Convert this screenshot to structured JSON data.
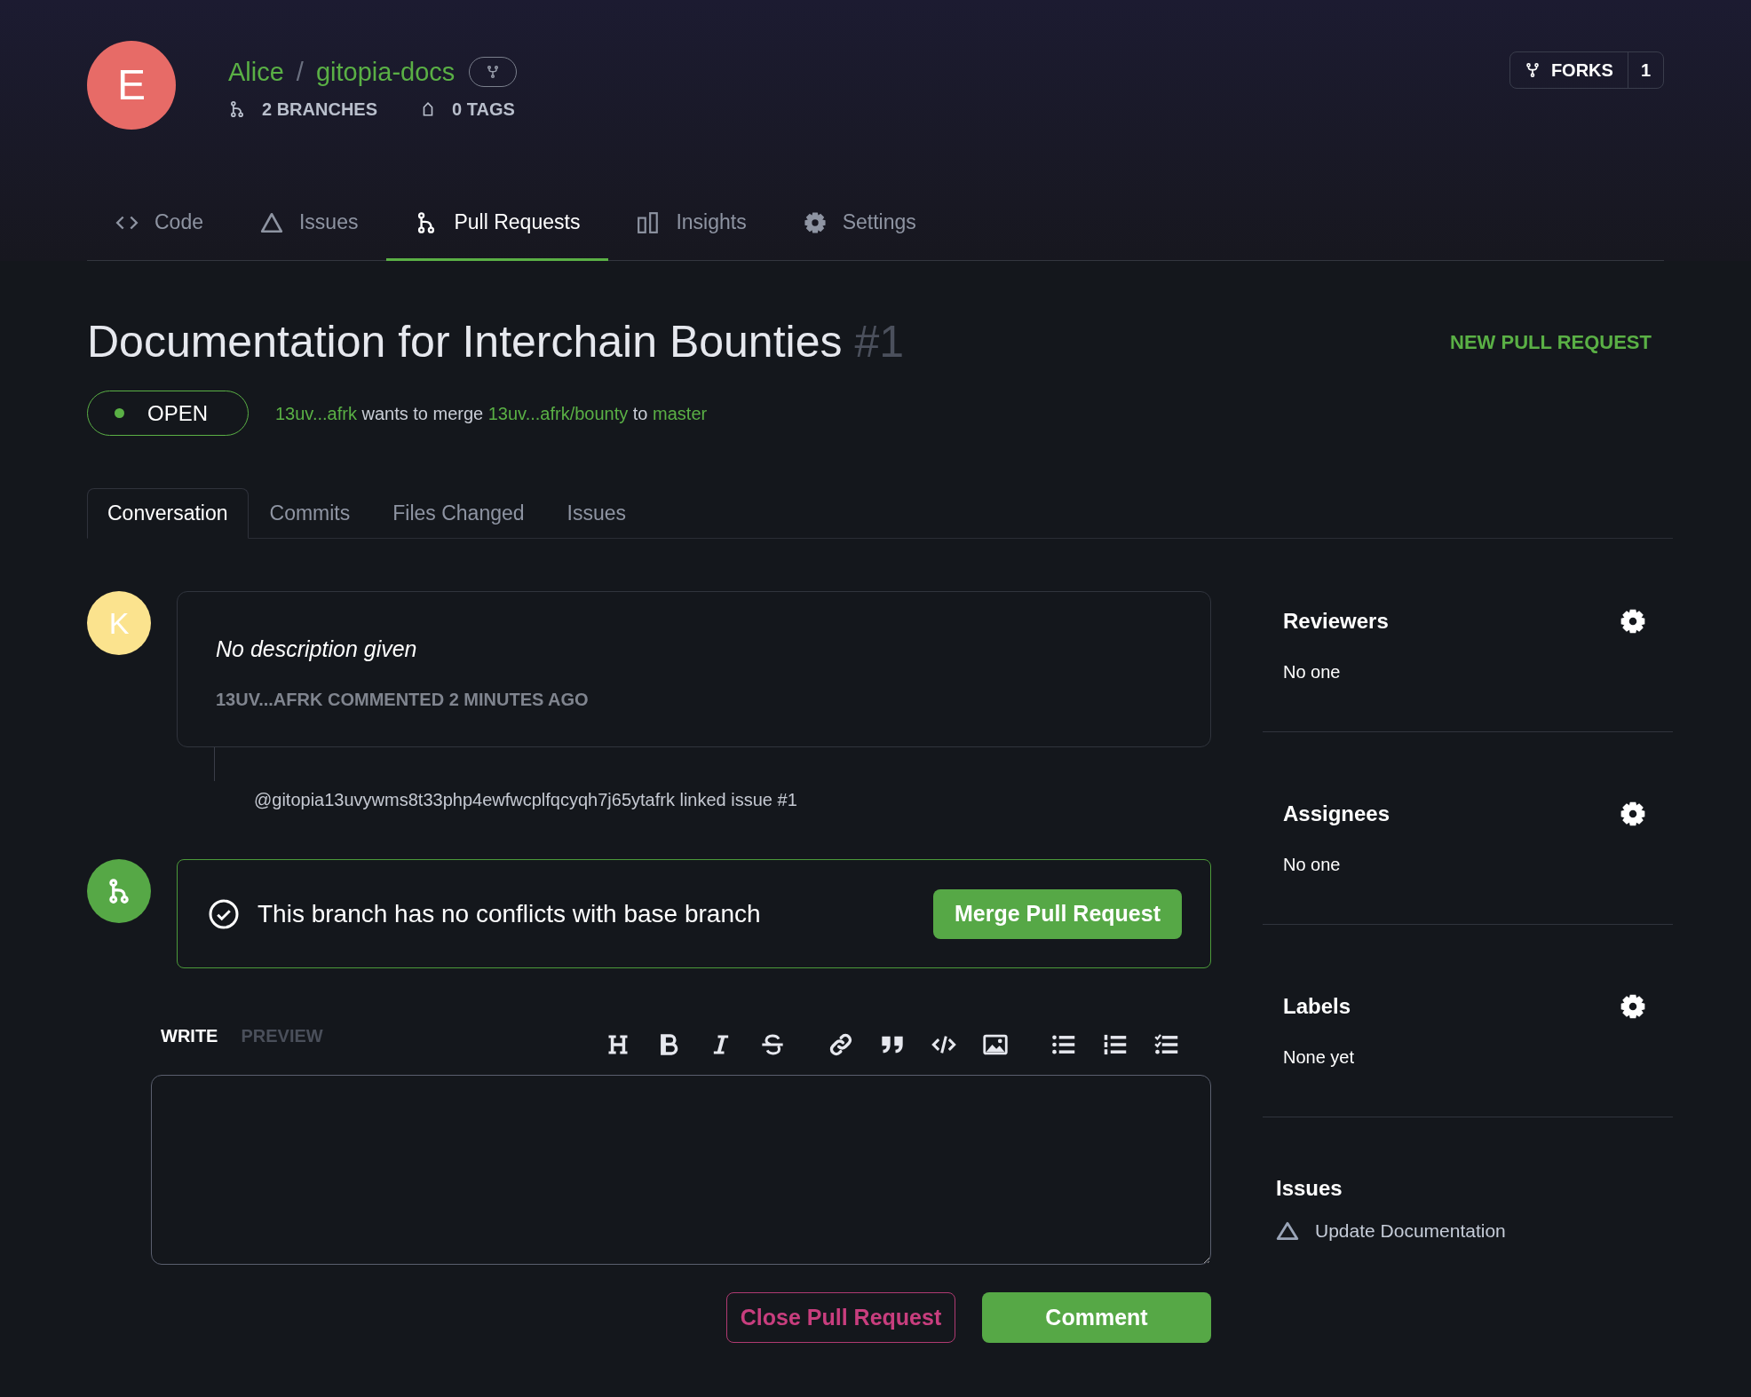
{
  "repo": {
    "avatar_letter": "E",
    "owner": "Alice",
    "separator": "/",
    "name": "gitopia-docs",
    "branches": "2 BRANCHES",
    "tags": "0 TAGS",
    "forks_label": "FORKS",
    "forks_count": "1"
  },
  "nav_tabs": [
    {
      "kind": "code",
      "label": "Code",
      "selected": false
    },
    {
      "kind": "issues",
      "label": "Issues",
      "selected": false
    },
    {
      "kind": "pulls",
      "label": "Pull Requests",
      "selected": true
    },
    {
      "kind": "insights",
      "label": "Insights",
      "selected": false
    },
    {
      "kind": "settings",
      "label": "Settings",
      "selected": false
    }
  ],
  "pull_request": {
    "title": "Documentation for Interchain Bounties",
    "number": "#1",
    "new_button": "NEW PULL REQUEST",
    "state": "OPEN",
    "author": "13uv...afrk",
    "merge_text": "wants to merge",
    "source": "13uv...afrk/bounty",
    "to_text": "to",
    "target": "master"
  },
  "sub_tabs": [
    {
      "label": "Conversation",
      "selected": true
    },
    {
      "label": "Commits",
      "selected": false
    },
    {
      "label": "Files Changed",
      "selected": false
    },
    {
      "label": "Issues",
      "selected": false
    }
  ],
  "timeline": [
    {
      "kind": "comment",
      "avatar_letter": "K",
      "body": "No description given",
      "meta": "13UV...AFRK COMMENTED 2 MINUTES AGO"
    },
    {
      "kind": "event",
      "text": "@gitopia13uvywms8t33php4ewfwcplfqcyqh7j65ytafrk linked issue #1"
    },
    {
      "kind": "merge_status",
      "text": "This branch has no conflicts with base branch",
      "button": "Merge Pull Request"
    }
  ],
  "editor": {
    "tabs": [
      {
        "label": "WRITE",
        "selected": true
      },
      {
        "label": "PREVIEW",
        "selected": false
      }
    ]
  },
  "actions": {
    "close": "Close Pull Request",
    "comment": "Comment"
  },
  "sidebar": {
    "sections": [
      {
        "title": "Reviewers",
        "value": "No one"
      },
      {
        "title": "Assignees",
        "value": "No one"
      },
      {
        "title": "Labels",
        "value": "None yet"
      }
    ],
    "issues": {
      "title": "Issues",
      "items": [
        "Update Documentation"
      ]
    }
  }
}
